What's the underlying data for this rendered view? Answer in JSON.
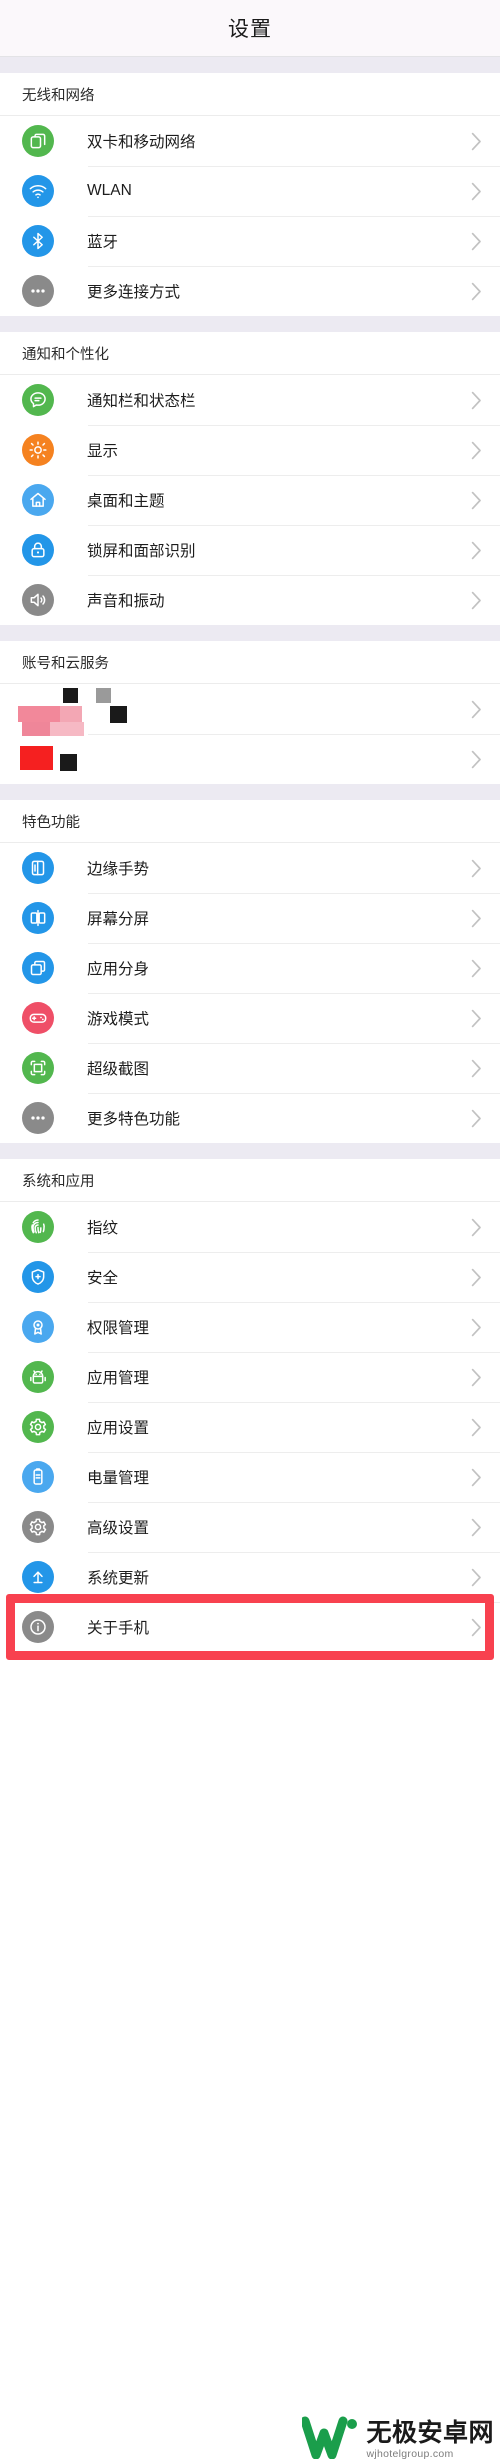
{
  "header": {
    "title": "设置"
  },
  "colors": {
    "green": "#52b74e",
    "blue": "#2396e8",
    "gray": "#8a8a8a",
    "orange": "#f58220",
    "lightblue": "#4aa8ef",
    "pink": "#ef4f67",
    "highlight": "#f8414f"
  },
  "sections": [
    {
      "title": "无线和网络",
      "items": [
        {
          "label": "双卡和移动网络",
          "icon": "sim-cards-icon",
          "color": "#52b74e"
        },
        {
          "label": "WLAN",
          "icon": "wifi-icon",
          "color": "#2396e8"
        },
        {
          "label": "蓝牙",
          "icon": "bluetooth-icon",
          "color": "#2396e8"
        },
        {
          "label": "更多连接方式",
          "icon": "more-dots-icon",
          "color": "#8a8a8a"
        }
      ]
    },
    {
      "title": "通知和个性化",
      "items": [
        {
          "label": "通知栏和状态栏",
          "icon": "chat-bubble-icon",
          "color": "#52b74e"
        },
        {
          "label": "显示",
          "icon": "brightness-icon",
          "color": "#f58220"
        },
        {
          "label": "桌面和主题",
          "icon": "home-icon",
          "color": "#4aa8ef"
        },
        {
          "label": "锁屏和面部识别",
          "icon": "lock-icon",
          "color": "#2396e8"
        },
        {
          "label": "声音和振动",
          "icon": "speaker-icon",
          "color": "#8a8a8a"
        }
      ]
    },
    {
      "title": "账号和云服务",
      "redacted": true,
      "items": [
        {
          "label": "",
          "icon": "redacted-icon",
          "color": "#cccccc"
        },
        {
          "label": "",
          "icon": "redacted-icon",
          "color": "#cccccc"
        }
      ]
    },
    {
      "title": "特色功能",
      "items": [
        {
          "label": "边缘手势",
          "icon": "edge-gesture-icon",
          "color": "#2396e8"
        },
        {
          "label": "屏幕分屏",
          "icon": "split-screen-icon",
          "color": "#2396e8"
        },
        {
          "label": "应用分身",
          "icon": "app-clone-icon",
          "color": "#2396e8"
        },
        {
          "label": "游戏模式",
          "icon": "gamepad-icon",
          "color": "#ef4f67"
        },
        {
          "label": "超级截图",
          "icon": "screenshot-icon",
          "color": "#52b74e"
        },
        {
          "label": "更多特色功能",
          "icon": "more-dots-icon",
          "color": "#8a8a8a"
        }
      ]
    },
    {
      "title": "系统和应用",
      "items": [
        {
          "label": "指纹",
          "icon": "fingerprint-icon",
          "color": "#52b74e"
        },
        {
          "label": "安全",
          "icon": "shield-icon",
          "color": "#2396e8"
        },
        {
          "label": "权限管理",
          "icon": "badge-icon",
          "color": "#4aa8ef"
        },
        {
          "label": "应用管理",
          "icon": "android-robot-icon",
          "color": "#52b74e"
        },
        {
          "label": "应用设置",
          "icon": "gear-icon",
          "color": "#52b74e"
        },
        {
          "label": "电量管理",
          "icon": "battery-icon",
          "color": "#4aa8ef"
        },
        {
          "label": "高级设置",
          "icon": "gear-icon",
          "color": "#8a8a8a"
        },
        {
          "label": "系统更新",
          "icon": "upload-arrow-icon",
          "color": "#2396e8"
        },
        {
          "label": "关于手机",
          "icon": "info-icon",
          "color": "#8a8a8a",
          "highlighted": true
        }
      ]
    }
  ],
  "watermark": {
    "main": "无极安卓网",
    "sub": "wjhotelgroup.com"
  }
}
